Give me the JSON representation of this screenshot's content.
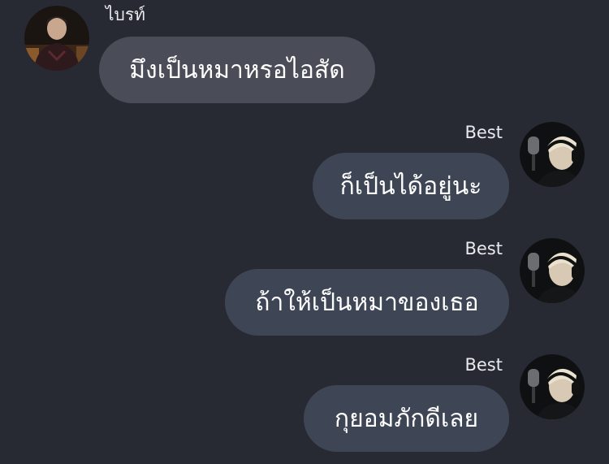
{
  "messages": [
    {
      "sender": "ไบรท์",
      "direction": "incoming",
      "text": "มึงเป็นหมาหรอไอสัด"
    },
    {
      "sender": "Best",
      "direction": "outgoing",
      "text": "ก็เป็นได้อยู่นะ"
    },
    {
      "sender": "Best",
      "direction": "outgoing",
      "text": "ถ้าให้เป็นหมาของเธอ"
    },
    {
      "sender": "Best",
      "direction": "outgoing",
      "text": "กุยอมภักดีเลย"
    }
  ],
  "colors": {
    "background": "#272a33",
    "incoming_bubble": "#4a4d57",
    "outgoing_bubble": "#3e4656",
    "text": "#ffffff"
  }
}
